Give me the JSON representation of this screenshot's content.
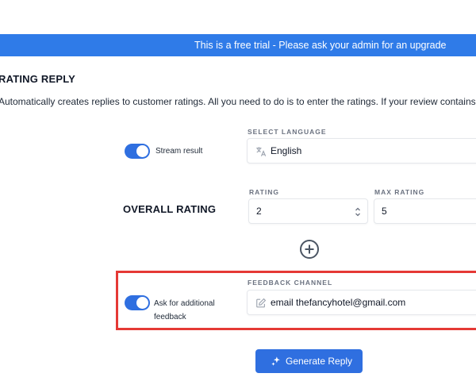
{
  "banner": {
    "text": "This is a free trial - Please ask your admin for an upgrade"
  },
  "page": {
    "title": "RATING REPLY",
    "description": "Automatically creates replies to customer ratings. All you need to do is to enter the ratings. If your review contains text"
  },
  "stream_toggle": {
    "label": "Stream result",
    "on": true
  },
  "language": {
    "label": "SELECT LANGUAGE",
    "value": "English"
  },
  "overall_rating": {
    "heading": "OVERALL RATING",
    "rating_label": "RATING",
    "rating_value": "2",
    "max_label": "MAX RATING",
    "max_value": "5"
  },
  "feedback": {
    "toggle_label_line1": "Ask for additional",
    "toggle_label_line2": "feedback",
    "on": true,
    "channel_label": "FEEDBACK CHANNEL",
    "channel_value": "email thefancyhotel@gmail.com"
  },
  "generate_button": {
    "label": "Generate Reply"
  },
  "icons": {
    "language": "translate-icon",
    "channel": "edit-icon",
    "add": "plus-circle-icon",
    "generate": "sparkle-icon"
  },
  "colors": {
    "banner": "#2f7be8",
    "accent": "#2f6fe0",
    "highlight": "#e53935"
  }
}
